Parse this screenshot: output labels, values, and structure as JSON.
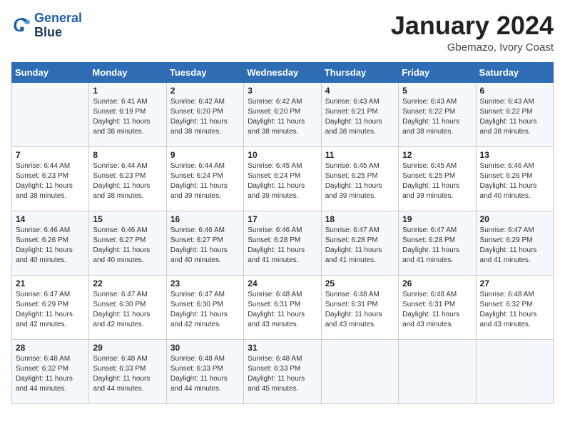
{
  "header": {
    "logo_line1": "General",
    "logo_line2": "Blue",
    "month": "January 2024",
    "location": "Gbemazo, Ivory Coast"
  },
  "weekdays": [
    "Sunday",
    "Monday",
    "Tuesday",
    "Wednesday",
    "Thursday",
    "Friday",
    "Saturday"
  ],
  "weeks": [
    [
      {
        "day": "",
        "info": ""
      },
      {
        "day": "1",
        "info": "Sunrise: 6:41 AM\nSunset: 6:19 PM\nDaylight: 11 hours\nand 38 minutes."
      },
      {
        "day": "2",
        "info": "Sunrise: 6:42 AM\nSunset: 6:20 PM\nDaylight: 11 hours\nand 38 minutes."
      },
      {
        "day": "3",
        "info": "Sunrise: 6:42 AM\nSunset: 6:20 PM\nDaylight: 11 hours\nand 38 minutes."
      },
      {
        "day": "4",
        "info": "Sunrise: 6:43 AM\nSunset: 6:21 PM\nDaylight: 11 hours\nand 38 minutes."
      },
      {
        "day": "5",
        "info": "Sunrise: 6:43 AM\nSunset: 6:22 PM\nDaylight: 11 hours\nand 38 minutes."
      },
      {
        "day": "6",
        "info": "Sunrise: 6:43 AM\nSunset: 6:22 PM\nDaylight: 11 hours\nand 38 minutes."
      }
    ],
    [
      {
        "day": "7",
        "info": "Sunrise: 6:44 AM\nSunset: 6:23 PM\nDaylight: 11 hours\nand 38 minutes."
      },
      {
        "day": "8",
        "info": "Sunrise: 6:44 AM\nSunset: 6:23 PM\nDaylight: 11 hours\nand 38 minutes."
      },
      {
        "day": "9",
        "info": "Sunrise: 6:44 AM\nSunset: 6:24 PM\nDaylight: 11 hours\nand 39 minutes."
      },
      {
        "day": "10",
        "info": "Sunrise: 6:45 AM\nSunset: 6:24 PM\nDaylight: 11 hours\nand 39 minutes."
      },
      {
        "day": "11",
        "info": "Sunrise: 6:45 AM\nSunset: 6:25 PM\nDaylight: 11 hours\nand 39 minutes."
      },
      {
        "day": "12",
        "info": "Sunrise: 6:45 AM\nSunset: 6:25 PM\nDaylight: 11 hours\nand 39 minutes."
      },
      {
        "day": "13",
        "info": "Sunrise: 6:46 AM\nSunset: 6:26 PM\nDaylight: 11 hours\nand 40 minutes."
      }
    ],
    [
      {
        "day": "14",
        "info": "Sunrise: 6:46 AM\nSunset: 6:26 PM\nDaylight: 11 hours\nand 40 minutes."
      },
      {
        "day": "15",
        "info": "Sunrise: 6:46 AM\nSunset: 6:27 PM\nDaylight: 11 hours\nand 40 minutes."
      },
      {
        "day": "16",
        "info": "Sunrise: 6:46 AM\nSunset: 6:27 PM\nDaylight: 11 hours\nand 40 minutes."
      },
      {
        "day": "17",
        "info": "Sunrise: 6:46 AM\nSunset: 6:28 PM\nDaylight: 11 hours\nand 41 minutes."
      },
      {
        "day": "18",
        "info": "Sunrise: 6:47 AM\nSunset: 6:28 PM\nDaylight: 11 hours\nand 41 minutes."
      },
      {
        "day": "19",
        "info": "Sunrise: 6:47 AM\nSunset: 6:28 PM\nDaylight: 11 hours\nand 41 minutes."
      },
      {
        "day": "20",
        "info": "Sunrise: 6:47 AM\nSunset: 6:29 PM\nDaylight: 11 hours\nand 41 minutes."
      }
    ],
    [
      {
        "day": "21",
        "info": "Sunrise: 6:47 AM\nSunset: 6:29 PM\nDaylight: 11 hours\nand 42 minutes."
      },
      {
        "day": "22",
        "info": "Sunrise: 6:47 AM\nSunset: 6:30 PM\nDaylight: 11 hours\nand 42 minutes."
      },
      {
        "day": "23",
        "info": "Sunrise: 6:47 AM\nSunset: 6:30 PM\nDaylight: 11 hours\nand 42 minutes."
      },
      {
        "day": "24",
        "info": "Sunrise: 6:48 AM\nSunset: 6:31 PM\nDaylight: 11 hours\nand 43 minutes."
      },
      {
        "day": "25",
        "info": "Sunrise: 6:48 AM\nSunset: 6:31 PM\nDaylight: 11 hours\nand 43 minutes."
      },
      {
        "day": "26",
        "info": "Sunrise: 6:48 AM\nSunset: 6:31 PM\nDaylight: 11 hours\nand 43 minutes."
      },
      {
        "day": "27",
        "info": "Sunrise: 6:48 AM\nSunset: 6:32 PM\nDaylight: 11 hours\nand 43 minutes."
      }
    ],
    [
      {
        "day": "28",
        "info": "Sunrise: 6:48 AM\nSunset: 6:32 PM\nDaylight: 11 hours\nand 44 minutes."
      },
      {
        "day": "29",
        "info": "Sunrise: 6:48 AM\nSunset: 6:33 PM\nDaylight: 11 hours\nand 44 minutes."
      },
      {
        "day": "30",
        "info": "Sunrise: 6:48 AM\nSunset: 6:33 PM\nDaylight: 11 hours\nand 44 minutes."
      },
      {
        "day": "31",
        "info": "Sunrise: 6:48 AM\nSunset: 6:33 PM\nDaylight: 11 hours\nand 45 minutes."
      },
      {
        "day": "",
        "info": ""
      },
      {
        "day": "",
        "info": ""
      },
      {
        "day": "",
        "info": ""
      }
    ]
  ]
}
